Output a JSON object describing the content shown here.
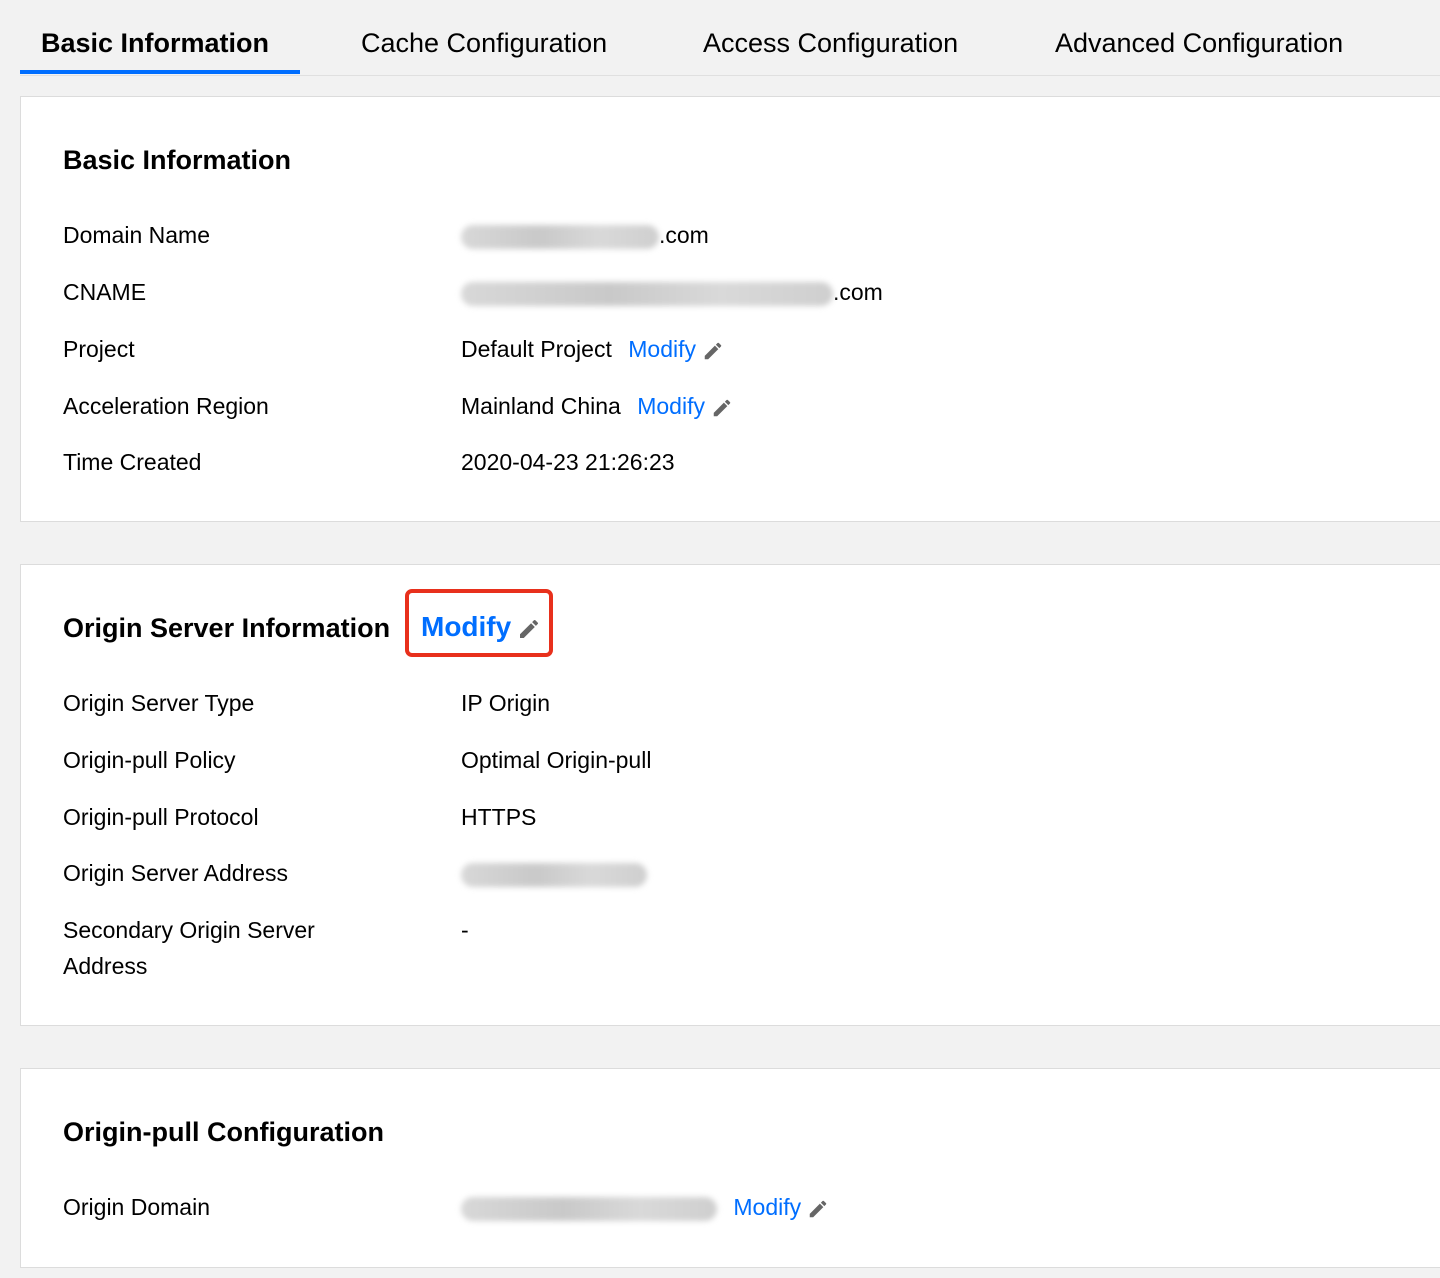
{
  "tabs": [
    {
      "label": "Basic Information",
      "active": true
    },
    {
      "label": "Cache Configuration",
      "active": false
    },
    {
      "label": "Access Configuration",
      "active": false
    },
    {
      "label": "Advanced Configuration",
      "active": false
    }
  ],
  "basic": {
    "title": "Basic Information",
    "rows": {
      "domain": {
        "label": "Domain Name",
        "value_suffix": ".com"
      },
      "cname": {
        "label": "CNAME",
        "value_suffix": ".com"
      },
      "project": {
        "label": "Project",
        "value": "Default Project",
        "action": "Modify"
      },
      "region": {
        "label": "Acceleration Region",
        "value": "Mainland China",
        "action": "Modify"
      },
      "created": {
        "label": "Time Created",
        "value": "2020-04-23 21:26:23"
      }
    }
  },
  "origin": {
    "title": "Origin Server Information",
    "action": "Modify",
    "rows": {
      "type": {
        "label": "Origin Server Type",
        "value": "IP Origin"
      },
      "policy": {
        "label": "Origin-pull Policy",
        "value": "Optimal Origin-pull"
      },
      "protocol": {
        "label": "Origin-pull Protocol",
        "value": "HTTPS"
      },
      "address": {
        "label": "Origin Server Address"
      },
      "secondary": {
        "label": "Secondary Origin Server Address",
        "value": "-"
      }
    }
  },
  "pull": {
    "title": "Origin-pull Configuration",
    "rows": {
      "domain": {
        "label": "Origin Domain",
        "action": "Modify"
      }
    }
  },
  "colors": {
    "link": "#006eff",
    "highlight": "#e8301c",
    "tab_underline": "#006eff"
  }
}
